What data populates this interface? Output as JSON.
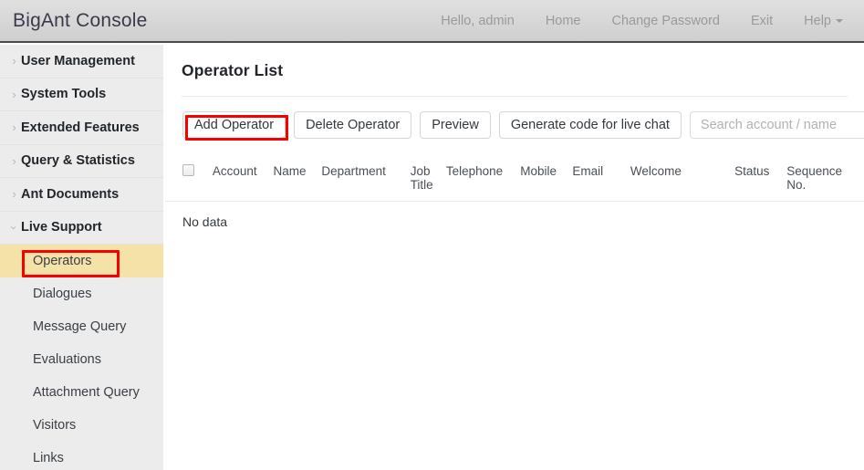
{
  "header": {
    "brand": "BigAnt Console",
    "nav": [
      {
        "label": "Hello, admin",
        "name": "greeting"
      },
      {
        "label": "Home",
        "name": "home"
      },
      {
        "label": "Change Password",
        "name": "change-password"
      },
      {
        "label": "Exit",
        "name": "exit"
      },
      {
        "label": "Help",
        "name": "help",
        "icon": "caret-down-icon"
      }
    ]
  },
  "sidebar": {
    "groups": [
      {
        "label": "User Management",
        "icon": "chevron-right-icon",
        "expanded": false
      },
      {
        "label": "System Tools",
        "icon": "chevron-right-icon",
        "expanded": false
      },
      {
        "label": "Extended Features",
        "icon": "chevron-right-icon",
        "expanded": false
      },
      {
        "label": "Query & Statistics",
        "icon": "chevron-right-icon",
        "expanded": false
      },
      {
        "label": "Ant Documents",
        "icon": "chevron-right-icon",
        "expanded": false
      },
      {
        "label": "Live Support",
        "icon": "chevron-down-icon",
        "expanded": true
      }
    ],
    "sub_items": [
      {
        "label": "Operators",
        "active": true
      },
      {
        "label": "Dialogues",
        "active": false
      },
      {
        "label": "Message Query",
        "active": false
      },
      {
        "label": "Evaluations",
        "active": false
      },
      {
        "label": "Attachment Query",
        "active": false
      },
      {
        "label": "Visitors",
        "active": false
      },
      {
        "label": "Links",
        "active": false
      }
    ],
    "active_highlight_color": "#f5e2a9"
  },
  "main": {
    "title": "Operator List",
    "toolbar": {
      "add_label": "Add Operator",
      "delete_label": "Delete Operator",
      "preview_label": "Preview",
      "generate_label": "Generate code for live chat",
      "search_placeholder": "Search account / name",
      "search_value": ""
    },
    "table": {
      "columns": [
        "Account",
        "Name",
        "Department",
        "Job Title",
        "Telephone",
        "Mobile",
        "Email",
        "Welcome",
        "Status",
        "Sequence No."
      ],
      "rows": [],
      "empty_text": "No data"
    }
  },
  "annotations": {
    "color": "#f60000",
    "boxes": [
      {
        "name": "add-operator-highlight",
        "target": "Add Operator"
      },
      {
        "name": "operators-highlight",
        "target": "Operators"
      }
    ]
  }
}
